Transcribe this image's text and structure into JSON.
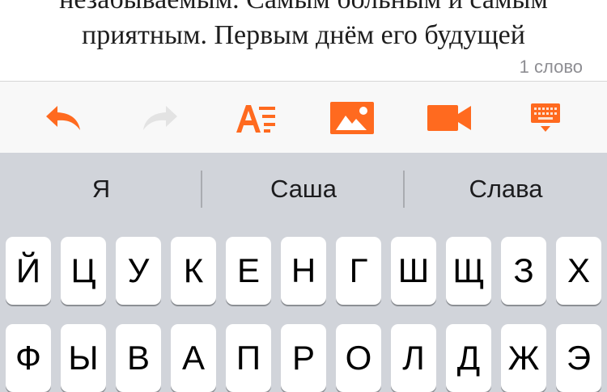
{
  "editor": {
    "line1": "незабываемым. Самым больным и самым",
    "line2": "приятным. Первым днём его будущей",
    "word_count": "1 слово"
  },
  "toolbar": {
    "buttons": [
      {
        "name": "undo",
        "icon": "undo-arrow-icon",
        "enabled": true
      },
      {
        "name": "redo",
        "icon": "redo-arrow-icon",
        "enabled": false
      },
      {
        "name": "text-format",
        "icon": "text-format-icon",
        "enabled": true
      },
      {
        "name": "insert-photo",
        "icon": "photo-icon",
        "enabled": true
      },
      {
        "name": "insert-video",
        "icon": "video-camera-icon",
        "enabled": true
      },
      {
        "name": "hide-keyboard",
        "icon": "keyboard-hide-icon",
        "enabled": true
      }
    ],
    "accent_color": "#ff6a1f",
    "disabled_color": "#e3e3e3"
  },
  "predictions": [
    "Я",
    "Саша",
    "Слава"
  ],
  "keyboard": {
    "row1": [
      "Й",
      "Ц",
      "У",
      "К",
      "Е",
      "Н",
      "Г",
      "Ш",
      "Щ",
      "З",
      "Х"
    ],
    "row2": [
      "Ф",
      "Ы",
      "В",
      "А",
      "П",
      "Р",
      "О",
      "Л",
      "Д",
      "Ж",
      "Э"
    ]
  }
}
